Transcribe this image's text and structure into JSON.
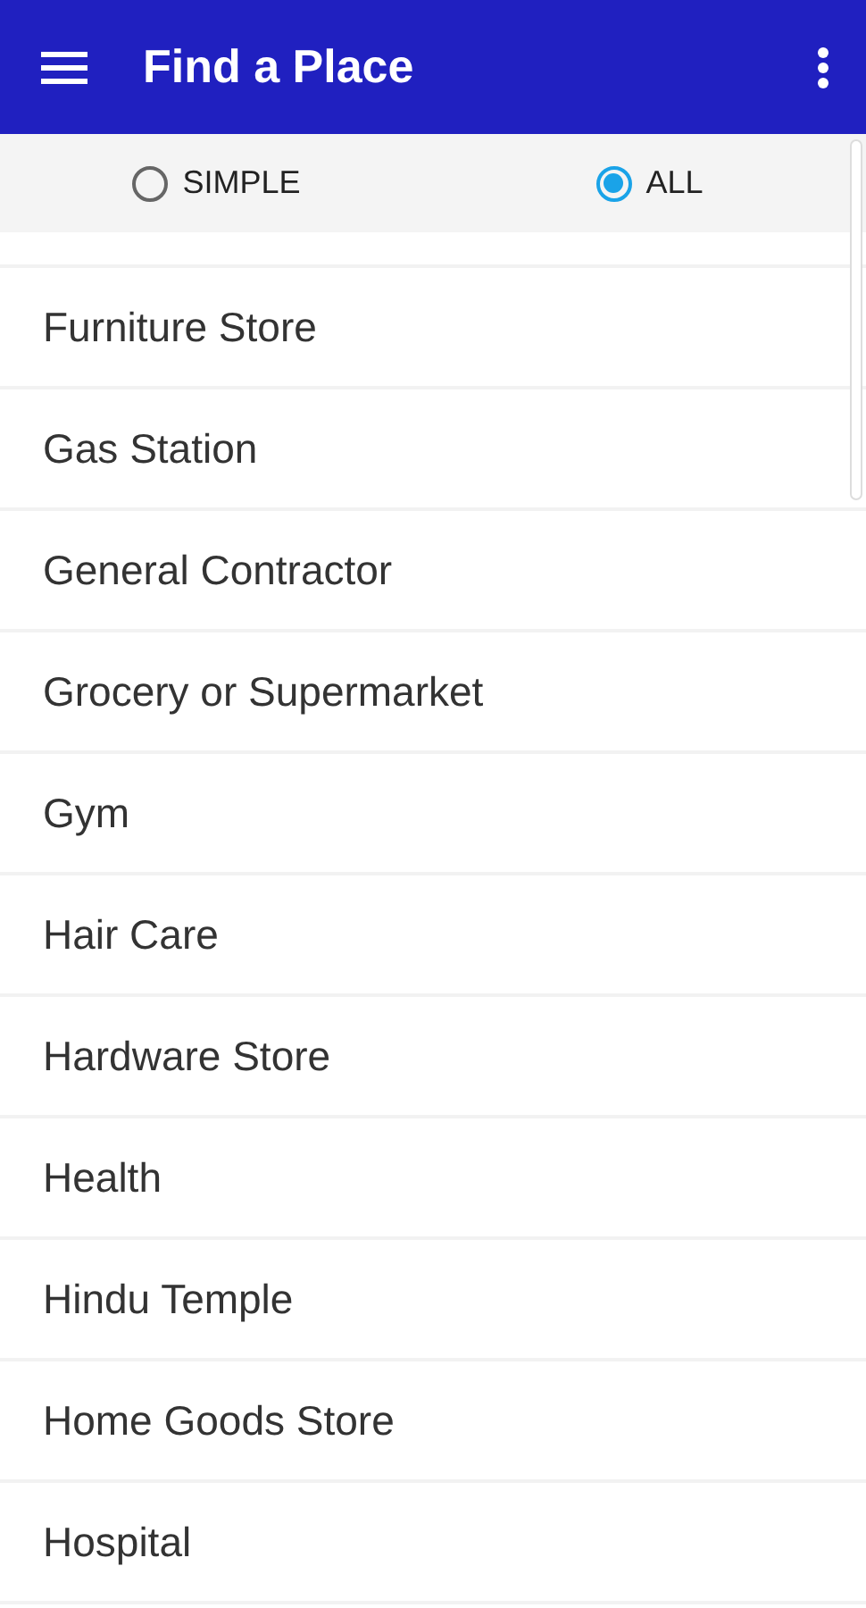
{
  "app_bar": {
    "title": "Find a Place"
  },
  "filter": [
    {
      "label": "SIMPLE",
      "selected": false
    },
    {
      "label": "ALL",
      "selected": true
    }
  ],
  "places": [
    {
      "name": "Furniture Store"
    },
    {
      "name": "Gas Station"
    },
    {
      "name": "General Contractor"
    },
    {
      "name": "Grocery or Supermarket"
    },
    {
      "name": "Gym"
    },
    {
      "name": "Hair Care"
    },
    {
      "name": "Hardware Store"
    },
    {
      "name": "Health"
    },
    {
      "name": "Hindu Temple"
    },
    {
      "name": "Home Goods Store"
    },
    {
      "name": "Hospital"
    }
  ]
}
